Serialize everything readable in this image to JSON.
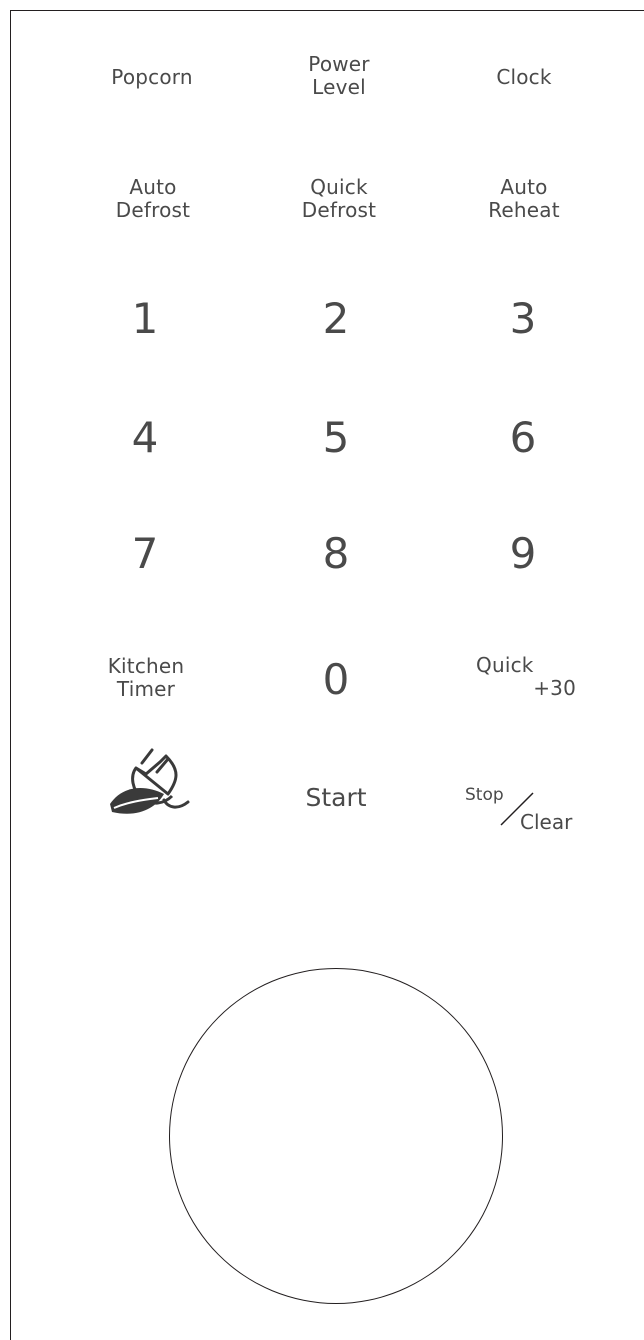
{
  "keys": {
    "popcorn": "Popcorn",
    "power_level": [
      "Power",
      "Level"
    ],
    "clock": "Clock",
    "auto_defrost": [
      "Auto",
      "Defrost"
    ],
    "quick_defrost": [
      "Quick",
      "Defrost"
    ],
    "auto_reheat": [
      "Auto",
      "Reheat"
    ],
    "digits": [
      "1",
      "2",
      "3",
      "4",
      "5",
      "6",
      "7",
      "8",
      "9",
      "0"
    ],
    "kitchen_timer": [
      "Kitchen",
      "Timer"
    ],
    "quick_30": [
      "Quick",
      "+30"
    ],
    "start": "Start",
    "stop": "Stop",
    "clear": "Clear"
  },
  "icons": {
    "eco": "eco-plug-leaf-icon"
  },
  "colors": {
    "text": "#4a4a4a",
    "outline": "#231f20",
    "eco_icon": "#3a3a3a"
  }
}
